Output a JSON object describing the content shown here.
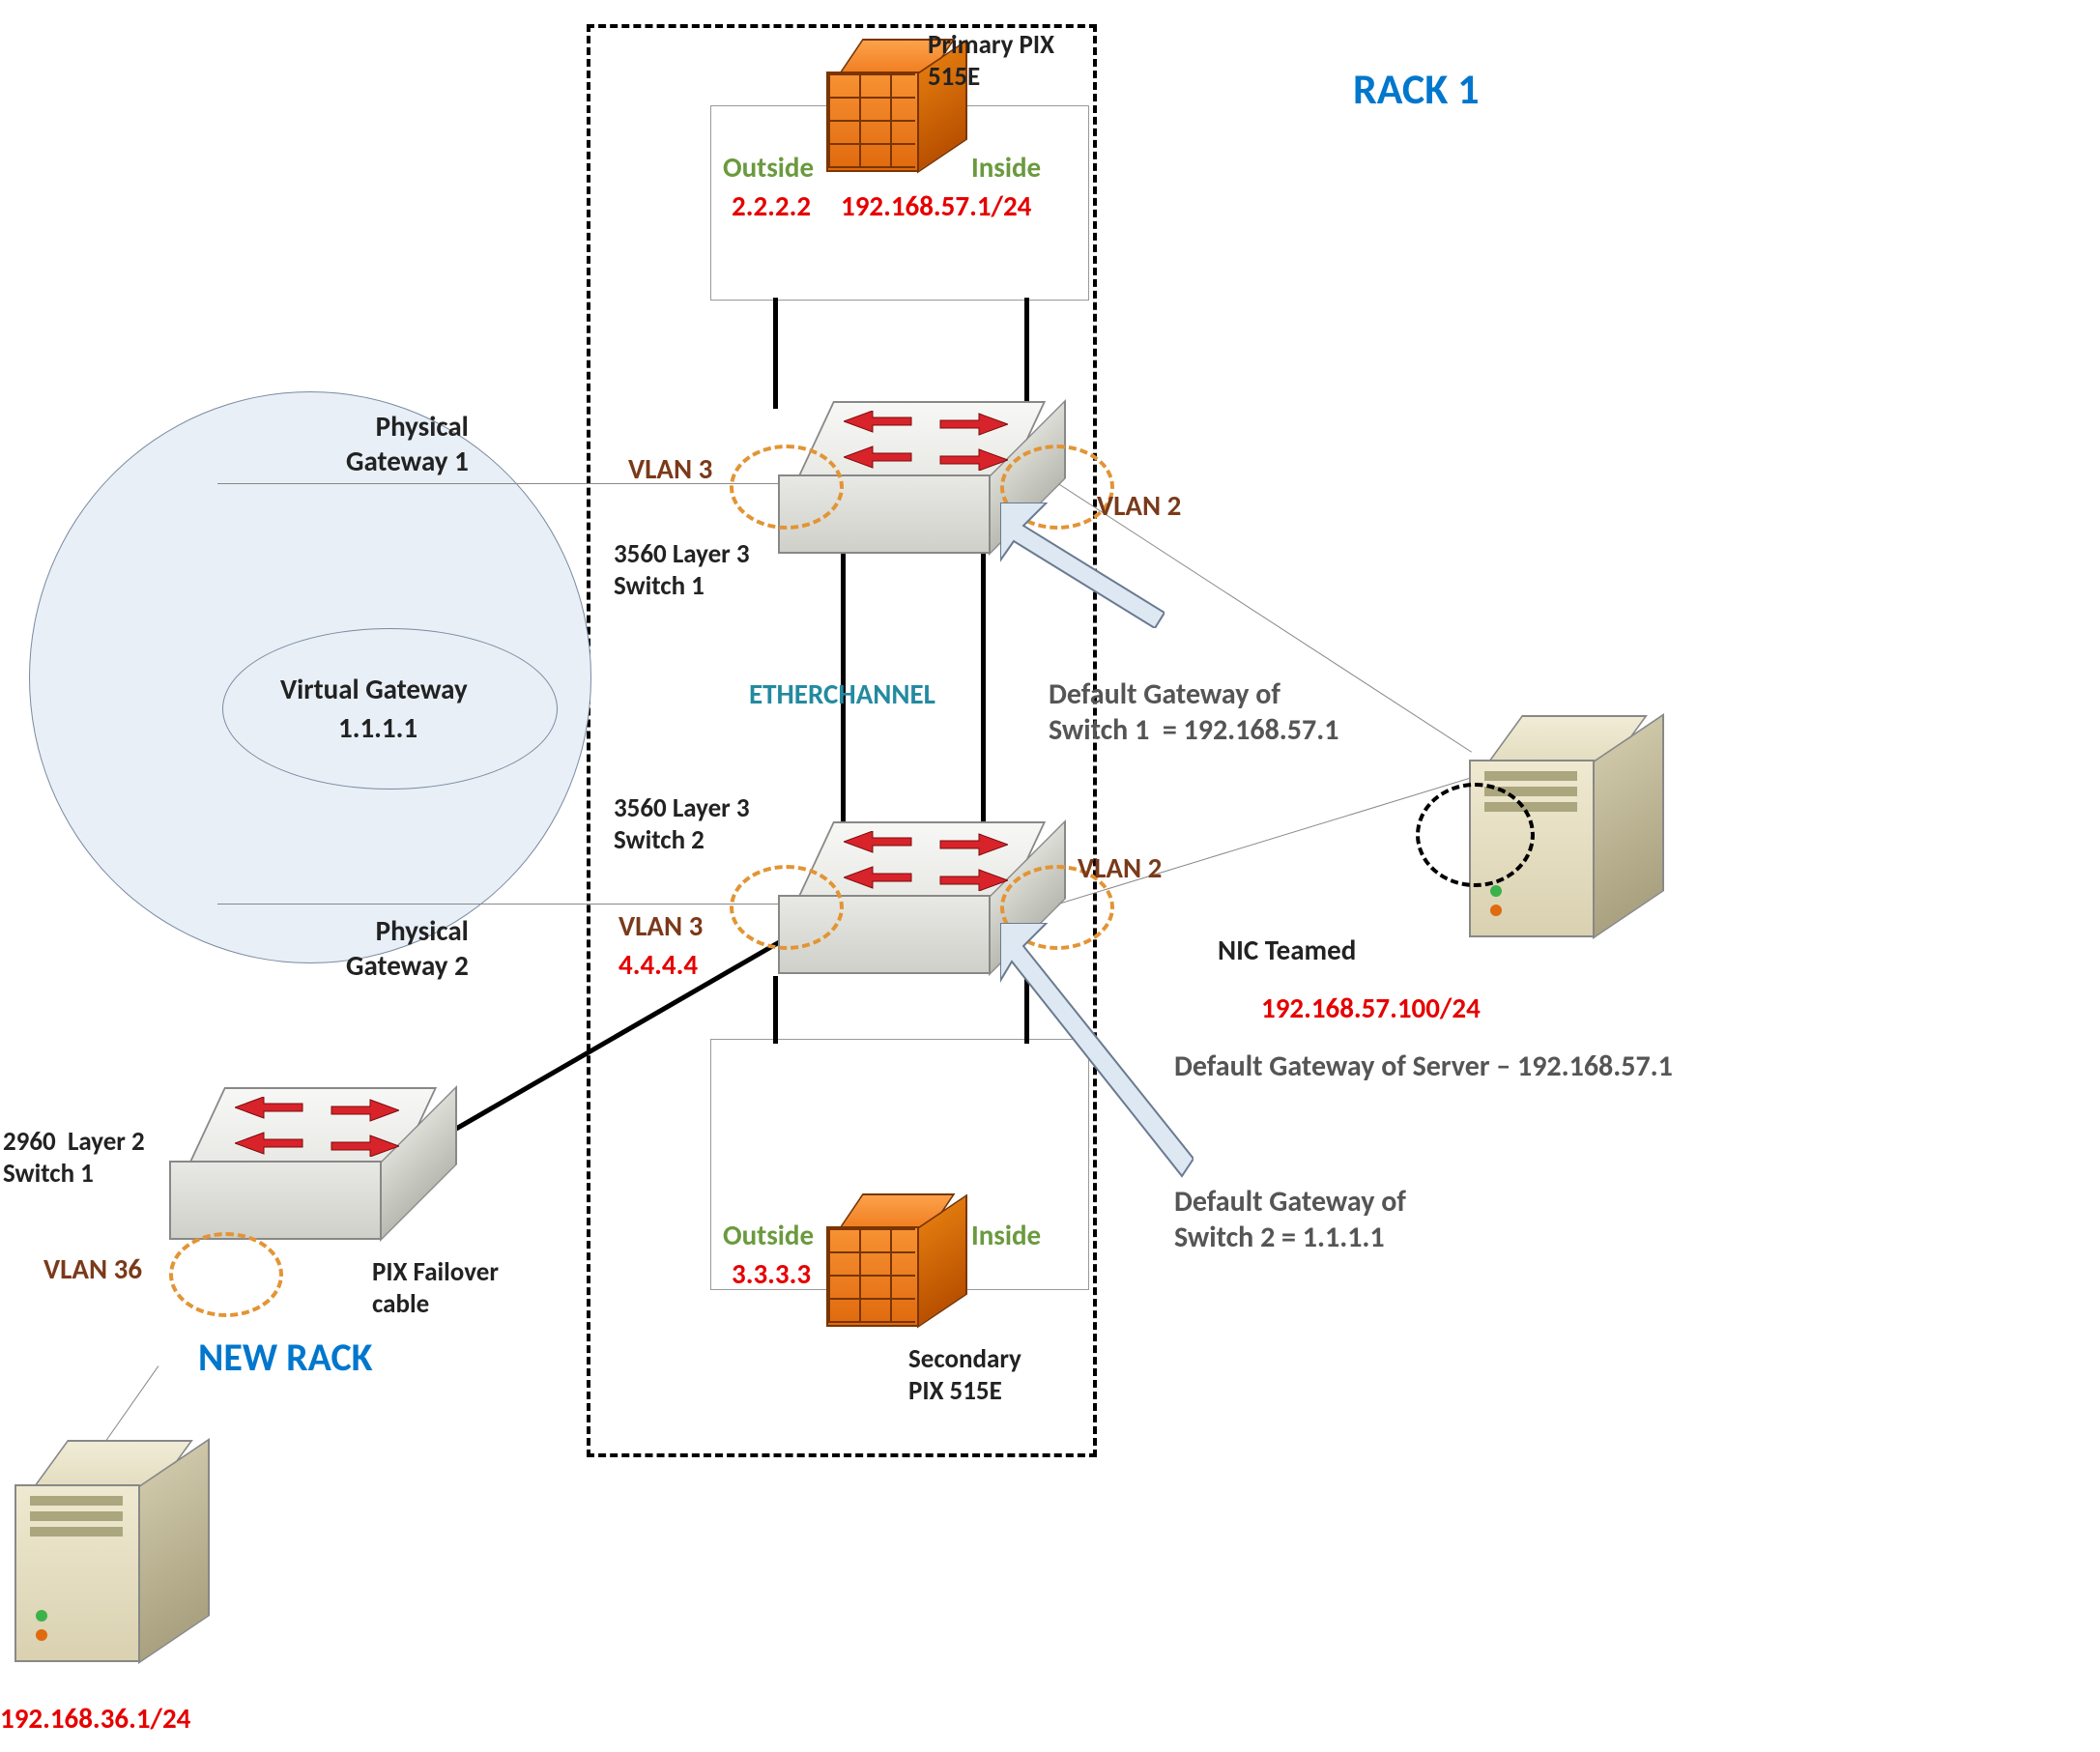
{
  "rack1_title": "RACK 1",
  "new_rack_title": "NEW RACK",
  "primary_pix": {
    "name": "Primary PIX\n515E",
    "outside_lbl": "Outside",
    "inside_lbl": "Inside",
    "outside_ip": "2.2.2.2",
    "inside_ip": "192.168.57.1/24"
  },
  "secondary_pix": {
    "name": "Secondary\nPIX 515E",
    "outside_lbl": "Outside",
    "inside_lbl": "Inside",
    "outside_ip": "3.3.3.3"
  },
  "switch1": {
    "name": "3560 Layer 3\nSwitch 1",
    "vlan_left": "VLAN 3",
    "vlan_right": "VLAN 2",
    "gw_text": "Default Gateway of\nSwitch 1  = 192.168.57.1"
  },
  "switch2": {
    "name": "3560 Layer 3\nSwitch 2",
    "vlan_left": "VLAN 3",
    "vlan_right": "VLAN 2",
    "vlan_left_ip": "4.4.4.4",
    "gw_text": "Default Gateway of\nSwitch 2 = 1.1.1.1"
  },
  "etherchannel": "ETHERCHANNEL",
  "phys_gw1": "Physical\nGateway 1",
  "phys_gw2": "Physical\nGateway 2",
  "virtual_gw": {
    "name": "Virtual Gateway",
    "ip": "1.1.1.1"
  },
  "l2_switch": {
    "name": "2960  Layer 2\nSwitch 1",
    "vlan": "VLAN 36"
  },
  "pix_failover": "PIX Failover\ncable",
  "server_right": {
    "nic": "NIC Teamed",
    "ip": "192.168.57.100/24",
    "gw": "Default Gateway of Server – 192.168.57.1"
  },
  "server_left": {
    "ip": "192.168.36.1/24"
  }
}
